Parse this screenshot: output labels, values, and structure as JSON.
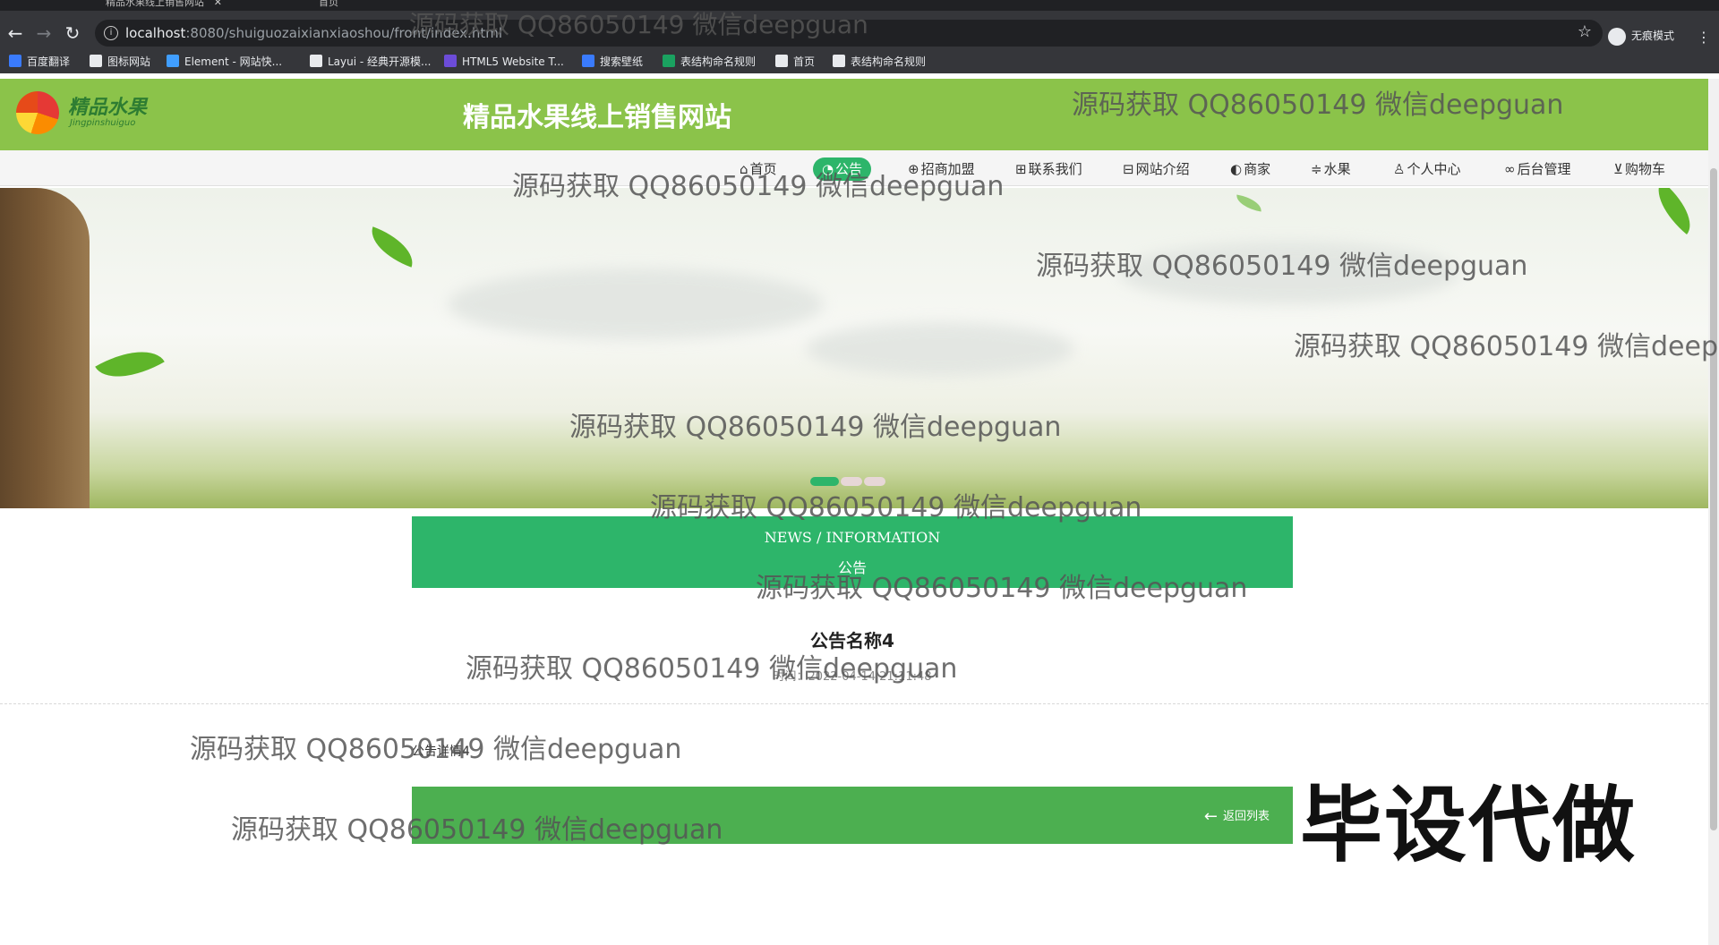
{
  "browser": {
    "tabs": [
      {
        "title": "精品水果线上销售网站"
      },
      {
        "title": "首页"
      }
    ],
    "url_host": "localhost",
    "url_rest": ":8080/shuiguozaixianxiaoshou/front/index.html",
    "incognito_label": "无痕模式",
    "bookmarks": [
      {
        "label": "百度翻译",
        "icon": "baidu-fanyi-icon",
        "color": "#3a7bfd"
      },
      {
        "label": "图标网站",
        "icon": "flag-icon",
        "color": "#e8eaed"
      },
      {
        "label": "Element - 网站快...",
        "icon": "element-icon",
        "color": "#409eff"
      },
      {
        "label": "Layui - 经典开源模...",
        "icon": "layui-icon",
        "color": "#e8eaed"
      },
      {
        "label": "HTML5 Website T...",
        "icon": "html5-icon",
        "color": "#6c4cd8"
      },
      {
        "label": "搜索壁纸",
        "icon": "wallpaper-icon",
        "color": "#3a7bfd"
      },
      {
        "label": "表结构命名规则",
        "icon": "sheet-icon",
        "color": "#1aa260"
      },
      {
        "label": "首页",
        "icon": "globe-icon",
        "color": "#e8eaed"
      },
      {
        "label": "表结构命名规则",
        "icon": "globe-icon",
        "color": "#e8eaed"
      }
    ]
  },
  "site": {
    "logo_text": "精品水果",
    "logo_sub": "Jingpinshuiguo",
    "title": "精品水果线上销售网站"
  },
  "menu": [
    {
      "label": "首页",
      "icon": "home-icon"
    },
    {
      "label": "公告",
      "icon": "bell-icon",
      "active": true
    },
    {
      "label": "招商加盟",
      "icon": "handshake-icon"
    },
    {
      "label": "联系我们",
      "icon": "grid-icon"
    },
    {
      "label": "网站介绍",
      "icon": "apps-icon"
    },
    {
      "label": "商家",
      "icon": "palette-icon"
    },
    {
      "label": "水果",
      "icon": "sliders-icon"
    },
    {
      "label": "个人中心",
      "icon": "user-icon"
    },
    {
      "label": "后台管理",
      "icon": "link-icon"
    },
    {
      "label": "购物车",
      "icon": "cart-icon"
    }
  ],
  "carousel": {
    "slide_count": 3,
    "active_index": 0
  },
  "news_banner": {
    "en": "NEWS / INFORMATION",
    "cn": "公告"
  },
  "article": {
    "title": "公告名称4",
    "time": "时间：2022-04-14 21:11:48",
    "detail": "公告详情4",
    "back_label": "返回列表"
  },
  "promo": "毕设代做",
  "watermark": "源码获取 QQ86050149 微信deepguan",
  "colors": {
    "header": "#8bc34a",
    "accent": "#2db56a",
    "bottom_bar": "#4caf50"
  }
}
